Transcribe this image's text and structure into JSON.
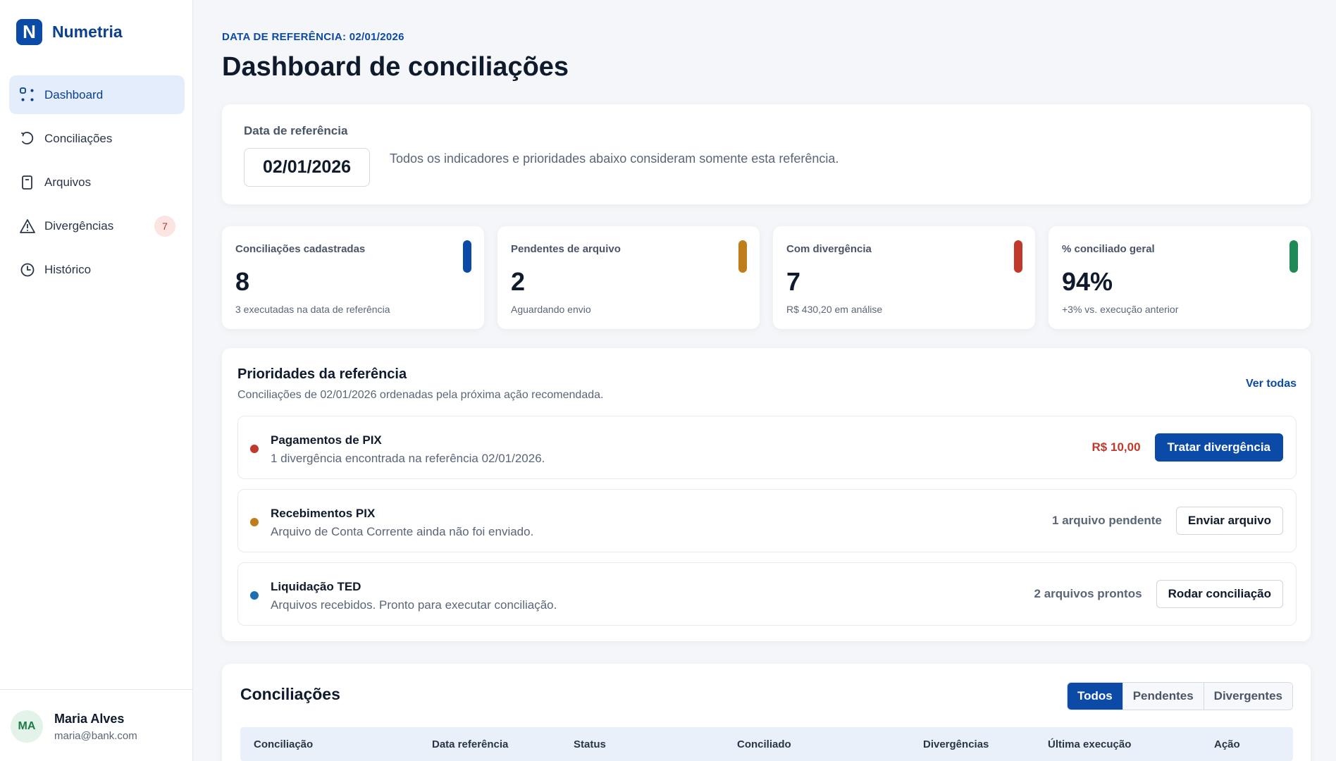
{
  "brand": {
    "logo_letter": "N",
    "name": "Numetria"
  },
  "sidebar": {
    "items": [
      {
        "label": "Dashboard",
        "icon": "dashboard-icon",
        "active": true
      },
      {
        "label": "Conciliações",
        "icon": "refresh-icon"
      },
      {
        "label": "Arquivos",
        "icon": "file-icon"
      },
      {
        "label": "Divergências",
        "icon": "warning-icon",
        "badge": "7"
      },
      {
        "label": "Histórico",
        "icon": "clock-icon"
      }
    ]
  },
  "user": {
    "initials": "MA",
    "name": "Maria Alves",
    "email": "maria@bank.com"
  },
  "header": {
    "eyebrow": "DATA DE REFERÊNCIA: 02/01/2026",
    "title": "Dashboard de conciliações"
  },
  "reference": {
    "label": "Data de referência",
    "date": "02/01/2026",
    "description": "Todos os indicadores e prioridades abaixo consideram somente esta referência."
  },
  "kpis": [
    {
      "title": "Conciliações cadastradas",
      "value": "8",
      "sub": "3 executadas na data de referência",
      "color": "#0b4aa6"
    },
    {
      "title": "Pendentes de arquivo",
      "value": "2",
      "sub": "Aguardando envio",
      "color": "#c07d1c"
    },
    {
      "title": "Com divergência",
      "value": "7",
      "sub": "R$ 430,20 em análise",
      "color": "#c0392b"
    },
    {
      "title": "% conciliado geral",
      "value": "94%",
      "sub": "+3% vs. execução anterior",
      "color": "#1f8a55"
    }
  ],
  "priorities": {
    "title": "Prioridades da referência",
    "subtitle": "Conciliações de 02/01/2026 ordenadas pela próxima ação recomendada.",
    "link": "Ver todas",
    "rows": [
      {
        "name": "Pagamentos de PIX",
        "desc": "1 divergência encontrada na referência 02/01/2026.",
        "meta": "R$ 10,00",
        "action": "Tratar divergência",
        "dot": "#c0392b"
      },
      {
        "name": "Recebimentos PIX",
        "desc": "Arquivo de Conta Corrente ainda não foi enviado.",
        "meta": "1 arquivo pendente",
        "action": "Enviar arquivo",
        "dot": "#c07d1c"
      },
      {
        "name": "Liquidação TED",
        "desc": "Arquivos recebidos. Pronto para executar conciliação.",
        "meta": "2 arquivos prontos",
        "action": "Rodar conciliação",
        "dot": "#1a6fb5"
      }
    ]
  },
  "reconciliations": {
    "title": "Conciliações",
    "filters": [
      "Todos",
      "Pendentes",
      "Divergentes"
    ],
    "active_filter": "Todos",
    "columns": [
      "Conciliação",
      "Data referência",
      "Status",
      "Conciliado",
      "Divergências",
      "Última execução",
      "Ação"
    ]
  }
}
